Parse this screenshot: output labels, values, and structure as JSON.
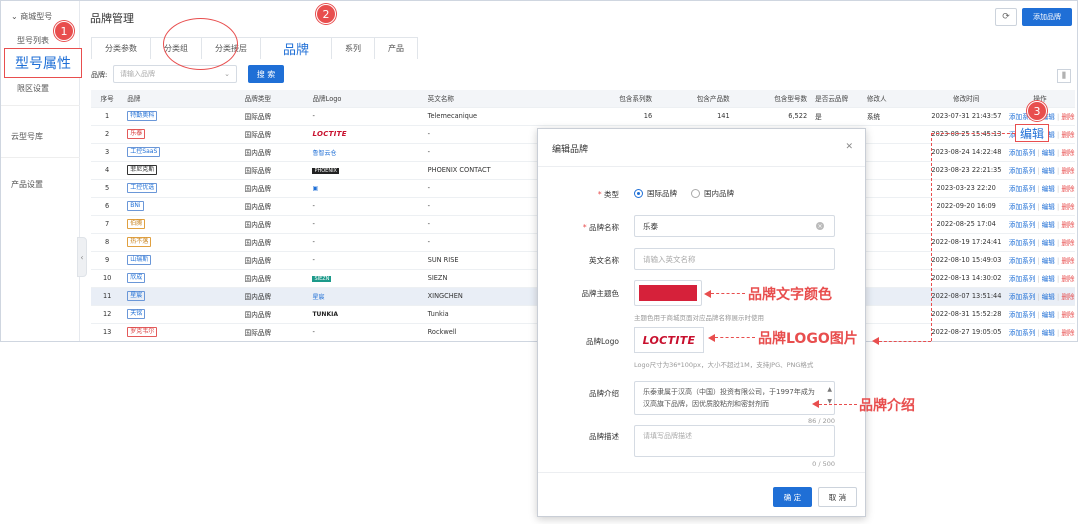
{
  "sidebar": {
    "section_store": "商城型号",
    "item_models": "型号列表",
    "item_attr_highlight": "型号属性",
    "item_region": "限区设置",
    "section_cloud": "云型号库",
    "section_product": "产品设置"
  },
  "header": {
    "title": "品牌管理",
    "add_button": "添加品牌"
  },
  "tabs": [
    {
      "label": "分类参数"
    },
    {
      "label": "分类组"
    },
    {
      "label": "分类接层"
    },
    {
      "label": "品牌"
    },
    {
      "label": "系列"
    },
    {
      "label": "产品"
    }
  ],
  "filter": {
    "label": "品牌:",
    "placeholder": "请输入品牌",
    "search_button": "搜 索"
  },
  "table": {
    "columns": [
      "序号",
      "品牌",
      "品牌类型",
      "品牌Logo",
      "英文名称",
      "包含系列数",
      "包含产品数",
      "包含型号数",
      "是否云品牌",
      "修改人",
      "修改时间",
      "操作"
    ],
    "rows": [
      {
        "no": "1",
        "brand": "特勤奥科",
        "type": "国际品牌",
        "logo": "-",
        "en": "Telemecanique",
        "series": "16",
        "products": "141",
        "models": "6,522",
        "cloud": "是",
        "editor": "系统",
        "time": "2023-07-31 21:43:57"
      },
      {
        "no": "2",
        "brand": "乐泰",
        "type": "国际品牌",
        "logo": "LOCTITE",
        "en": "-",
        "series": "",
        "products": "",
        "models": "",
        "cloud": "",
        "editor": "",
        "time": "2023-08-25 15:45:13"
      },
      {
        "no": "3",
        "brand": "工控SaaS",
        "type": "国内品牌",
        "logo": "鲁智云仓",
        "en": "-",
        "series": "",
        "products": "",
        "models": "",
        "cloud": "",
        "editor": "",
        "time": "2023-08-24 14:22:48"
      },
      {
        "no": "4",
        "brand": "菲尼克斯",
        "type": "国际品牌",
        "logo": "PHOENIX",
        "en": "PHOENIX CONTACT",
        "series": "",
        "products": "",
        "models": "",
        "cloud": "",
        "editor": "",
        "time": "2023-08-23 22:21:35"
      },
      {
        "no": "5",
        "brand": "工控优选",
        "type": "国内品牌",
        "logo": "img",
        "en": "-",
        "series": "",
        "products": "",
        "models": "",
        "cloud": "",
        "editor": "",
        "time": "2023-03-23 22:20"
      },
      {
        "no": "6",
        "brand": "BNi",
        "type": "国内品牌",
        "logo": "-",
        "en": "-",
        "series": "",
        "products": "",
        "models": "",
        "cloud": "",
        "editor": "",
        "time": "2022-09-20 16:09"
      },
      {
        "no": "7",
        "brand": "伯腾",
        "type": "国内品牌",
        "logo": "-",
        "en": "-",
        "series": "",
        "products": "",
        "models": "",
        "cloud": "",
        "editor": "",
        "time": "2022-08-25 17:04"
      },
      {
        "no": "8",
        "brand": "热不落",
        "type": "国内品牌",
        "logo": "-",
        "en": "-",
        "series": "",
        "products": "",
        "models": "",
        "cloud": "",
        "editor": "",
        "time": "2022-08-19 17:24:41"
      },
      {
        "no": "9",
        "brand": "山瑞斯",
        "type": "国内品牌",
        "logo": "-",
        "en": "SUN RISE",
        "series": "",
        "products": "",
        "models": "",
        "cloud": "",
        "editor": "",
        "time": "2022-08-10 15:49:03"
      },
      {
        "no": "10",
        "brand": "欣成",
        "type": "国内品牌",
        "logo": "SIEZN",
        "en": "SIEZN",
        "series": "",
        "products": "",
        "models": "",
        "cloud": "",
        "editor": "",
        "time": "2022-08-13 14:30:02"
      },
      {
        "no": "11",
        "brand": "星宸",
        "type": "国内品牌",
        "logo": "星宸",
        "en": "XINGCHEN",
        "series": "",
        "products": "",
        "models": "",
        "cloud": "",
        "editor": "",
        "time": "2022-08-07 13:51:44"
      },
      {
        "no": "12",
        "brand": "天铭",
        "type": "国内品牌",
        "logo": "TUNKIA",
        "en": "Tunkia",
        "series": "",
        "products": "",
        "models": "",
        "cloud": "",
        "editor": "",
        "time": "2022-08-31 15:52:28"
      },
      {
        "no": "13",
        "brand": "罗克韦尔",
        "type": "国际品牌",
        "logo": "-",
        "en": "Rockwell",
        "series": "",
        "products": "",
        "models": "",
        "cloud": "",
        "editor": "",
        "time": "2022-08-27 19:05:05"
      }
    ],
    "op_add": "添加系列",
    "op_edit": "编辑",
    "op_delete": "删除"
  },
  "edit_highlight": "编辑",
  "modal": {
    "title": "编辑品牌",
    "type_label": "类型",
    "type_intl": "国际品牌",
    "type_domestic": "国内品牌",
    "name_label": "品牌名称",
    "name_value": "乐泰",
    "en_label": "英文名称",
    "en_placeholder": "请输入英文名称",
    "color_label": "品牌主题色",
    "color_value": "#d6213a",
    "color_hint": "主题色用于商城页面对应品牌名称展示时使用",
    "logo_label": "品牌Logo",
    "logo_text": "LOCTITE",
    "logo_hint": "Logo尺寸为36*100px，大小不超过1M，支持JPG、PNG格式",
    "intro_label": "品牌介绍",
    "intro_value": "乐泰隶属于汉高（中国）投资有限公司，于1997年成为汉高旗下品牌，因优质胶粘剂和密封剂而",
    "intro_count": "86 / 200",
    "desc_label": "品牌描述",
    "desc_placeholder": "请填写品牌描述",
    "desc_count": "0 / 500",
    "ok": "确 定",
    "cancel": "取 消"
  },
  "annotations": {
    "num1": "1",
    "num2": "2",
    "num3": "3",
    "color_note": "品牌文字颜色",
    "logo_note": "品牌LOGO图片",
    "intro_note": "品牌介绍"
  },
  "colors": {
    "accent": "#1f6fd6",
    "annotation": "#e84e4e",
    "brand_theme": "#d6213a"
  }
}
